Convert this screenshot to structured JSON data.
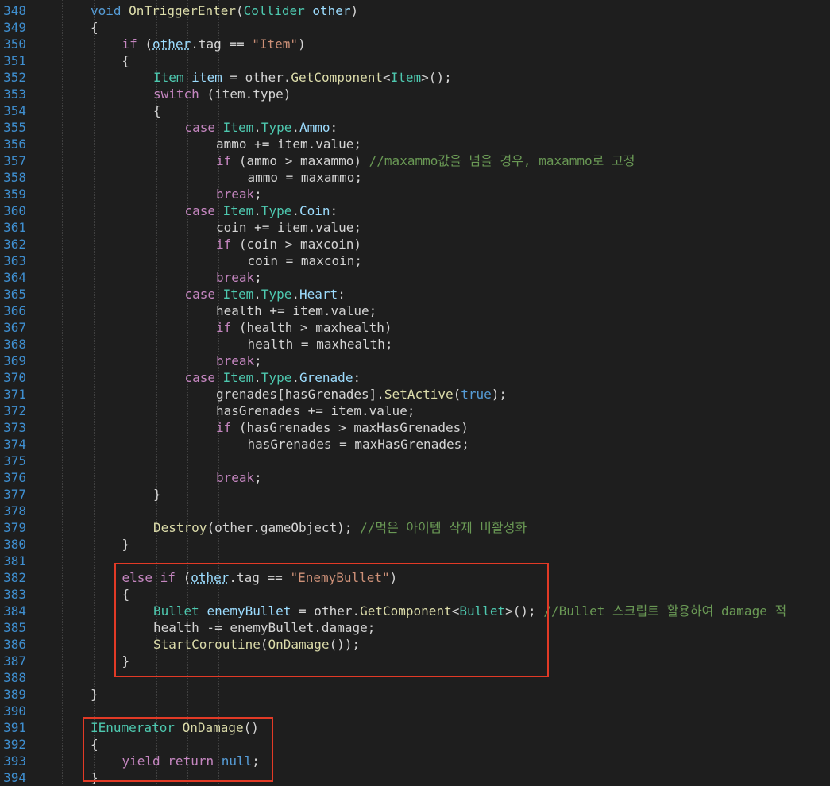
{
  "editor": {
    "language": "C#",
    "colors": {
      "background": "#1e1e1e",
      "line_number": "#3f8fd0",
      "keyword": "#569cd6",
      "control": "#c586c0",
      "function": "#dcdcaa",
      "type": "#4ec9b0",
      "string": "#ce9178",
      "comment": "#6a9955",
      "highlight_box": "#e23a26"
    },
    "lines": [
      {
        "n": "348",
        "indent": 1,
        "tokens": [
          [
            "kw",
            "void "
          ],
          [
            "fn",
            "OnTriggerEnter"
          ],
          [
            "plain",
            "("
          ],
          [
            "ty",
            "Collider"
          ],
          [
            "plain",
            " "
          ],
          [
            "var",
            "other"
          ],
          [
            "plain",
            ")"
          ]
        ]
      },
      {
        "n": "349",
        "indent": 1,
        "tokens": [
          [
            "plain",
            "{"
          ]
        ]
      },
      {
        "n": "350",
        "indent": 2,
        "tokens": [
          [
            "ctl",
            "if"
          ],
          [
            "plain",
            " ("
          ],
          [
            "dotvar",
            "other"
          ],
          [
            "plain",
            ".tag == "
          ],
          [
            "str",
            "\"Item\""
          ],
          [
            "plain",
            ")"
          ]
        ]
      },
      {
        "n": "351",
        "indent": 2,
        "tokens": [
          [
            "plain",
            "{"
          ]
        ]
      },
      {
        "n": "352",
        "indent": 3,
        "tokens": [
          [
            "ty",
            "Item"
          ],
          [
            "plain",
            " "
          ],
          [
            "var",
            "item"
          ],
          [
            "plain",
            " = other."
          ],
          [
            "fn",
            "GetComponent"
          ],
          [
            "plain",
            "<"
          ],
          [
            "ty",
            "Item"
          ],
          [
            "plain",
            ">();"
          ]
        ]
      },
      {
        "n": "353",
        "indent": 3,
        "tokens": [
          [
            "ctl",
            "switch"
          ],
          [
            "plain",
            " (item.type)"
          ]
        ]
      },
      {
        "n": "354",
        "indent": 3,
        "tokens": [
          [
            "plain",
            "{"
          ]
        ]
      },
      {
        "n": "355",
        "indent": 4,
        "tokens": [
          [
            "ctl",
            "case"
          ],
          [
            "plain",
            " "
          ],
          [
            "ty",
            "Item"
          ],
          [
            "plain",
            "."
          ],
          [
            "ty",
            "Type"
          ],
          [
            "plain",
            "."
          ],
          [
            "var",
            "Ammo"
          ],
          [
            "plain",
            ":"
          ]
        ]
      },
      {
        "n": "356",
        "indent": 5,
        "tokens": [
          [
            "plain",
            "ammo += item.value;"
          ]
        ]
      },
      {
        "n": "357",
        "indent": 5,
        "tokens": [
          [
            "ctl",
            "if"
          ],
          [
            "plain",
            " (ammo > maxammo) "
          ],
          [
            "cm",
            "//maxammo값을 넘을 경우, maxammo로 고정"
          ]
        ]
      },
      {
        "n": "358",
        "indent": 6,
        "tokens": [
          [
            "plain",
            "ammo = maxammo;"
          ]
        ]
      },
      {
        "n": "359",
        "indent": 5,
        "tokens": [
          [
            "ctl",
            "break"
          ],
          [
            "plain",
            ";"
          ]
        ]
      },
      {
        "n": "360",
        "indent": 4,
        "tokens": [
          [
            "ctl",
            "case"
          ],
          [
            "plain",
            " "
          ],
          [
            "ty",
            "Item"
          ],
          [
            "plain",
            "."
          ],
          [
            "ty",
            "Type"
          ],
          [
            "plain",
            "."
          ],
          [
            "var",
            "Coin"
          ],
          [
            "plain",
            ":"
          ]
        ]
      },
      {
        "n": "361",
        "indent": 5,
        "tokens": [
          [
            "plain",
            "coin += item.value;"
          ]
        ]
      },
      {
        "n": "362",
        "indent": 5,
        "tokens": [
          [
            "ctl",
            "if"
          ],
          [
            "plain",
            " (coin > maxcoin)"
          ]
        ]
      },
      {
        "n": "363",
        "indent": 6,
        "tokens": [
          [
            "plain",
            "coin = maxcoin;"
          ]
        ]
      },
      {
        "n": "364",
        "indent": 5,
        "tokens": [
          [
            "ctl",
            "break"
          ],
          [
            "plain",
            ";"
          ]
        ]
      },
      {
        "n": "365",
        "indent": 4,
        "tokens": [
          [
            "ctl",
            "case"
          ],
          [
            "plain",
            " "
          ],
          [
            "ty",
            "Item"
          ],
          [
            "plain",
            "."
          ],
          [
            "ty",
            "Type"
          ],
          [
            "plain",
            "."
          ],
          [
            "var",
            "Heart"
          ],
          [
            "plain",
            ":"
          ]
        ]
      },
      {
        "n": "366",
        "indent": 5,
        "tokens": [
          [
            "plain",
            "health += item.value;"
          ]
        ]
      },
      {
        "n": "367",
        "indent": 5,
        "tokens": [
          [
            "ctl",
            "if"
          ],
          [
            "plain",
            " (health > maxhealth)"
          ]
        ]
      },
      {
        "n": "368",
        "indent": 6,
        "tokens": [
          [
            "plain",
            "health = maxhealth;"
          ]
        ]
      },
      {
        "n": "369",
        "indent": 5,
        "tokens": [
          [
            "ctl",
            "break"
          ],
          [
            "plain",
            ";"
          ]
        ]
      },
      {
        "n": "370",
        "indent": 4,
        "tokens": [
          [
            "ctl",
            "case"
          ],
          [
            "plain",
            " "
          ],
          [
            "ty",
            "Item"
          ],
          [
            "plain",
            "."
          ],
          [
            "ty",
            "Type"
          ],
          [
            "plain",
            "."
          ],
          [
            "var",
            "Grenade"
          ],
          [
            "plain",
            ":"
          ]
        ]
      },
      {
        "n": "371",
        "indent": 5,
        "tokens": [
          [
            "plain",
            "grenades[hasGrenades]."
          ],
          [
            "fn",
            "SetActive"
          ],
          [
            "plain",
            "("
          ],
          [
            "kw",
            "true"
          ],
          [
            "plain",
            ");"
          ]
        ]
      },
      {
        "n": "372",
        "indent": 5,
        "tokens": [
          [
            "plain",
            "hasGrenades += item.value;"
          ]
        ]
      },
      {
        "n": "373",
        "indent": 5,
        "tokens": [
          [
            "ctl",
            "if"
          ],
          [
            "plain",
            " (hasGrenades > maxHasGrenades)"
          ]
        ]
      },
      {
        "n": "374",
        "indent": 6,
        "tokens": [
          [
            "plain",
            "hasGrenades = maxHasGrenades;"
          ]
        ]
      },
      {
        "n": "375",
        "indent": 0,
        "tokens": []
      },
      {
        "n": "376",
        "indent": 5,
        "tokens": [
          [
            "ctl",
            "break"
          ],
          [
            "plain",
            ";"
          ]
        ]
      },
      {
        "n": "377",
        "indent": 3,
        "tokens": [
          [
            "plain",
            "}"
          ]
        ]
      },
      {
        "n": "378",
        "indent": 0,
        "tokens": []
      },
      {
        "n": "379",
        "indent": 3,
        "tokens": [
          [
            "fn",
            "Destroy"
          ],
          [
            "plain",
            "(other.gameObject); "
          ],
          [
            "cm",
            "//먹은 아이템 삭제 비활성화"
          ]
        ]
      },
      {
        "n": "380",
        "indent": 2,
        "tokens": [
          [
            "plain",
            "}"
          ]
        ]
      },
      {
        "n": "381",
        "indent": 0,
        "tokens": []
      },
      {
        "n": "382",
        "indent": 2,
        "tokens": [
          [
            "ctl",
            "else if"
          ],
          [
            "plain",
            " ("
          ],
          [
            "dotvar",
            "other"
          ],
          [
            "plain",
            ".tag == "
          ],
          [
            "str",
            "\"EnemyBullet\""
          ],
          [
            "plain",
            ")"
          ]
        ]
      },
      {
        "n": "383",
        "indent": 2,
        "tokens": [
          [
            "plain",
            "{"
          ]
        ]
      },
      {
        "n": "384",
        "indent": 3,
        "tokens": [
          [
            "ty",
            "Bullet"
          ],
          [
            "plain",
            " "
          ],
          [
            "var",
            "enemyBullet"
          ],
          [
            "plain",
            " = other."
          ],
          [
            "fn",
            "GetComponent"
          ],
          [
            "plain",
            "<"
          ],
          [
            "ty",
            "Bullet"
          ],
          [
            "plain",
            ">(); "
          ],
          [
            "cm",
            "//Bullet 스크립트 활용하여 damage 적"
          ]
        ]
      },
      {
        "n": "385",
        "indent": 3,
        "tokens": [
          [
            "plain",
            "health -= enemyBullet.damage;"
          ]
        ]
      },
      {
        "n": "386",
        "indent": 3,
        "tokens": [
          [
            "fn",
            "StartCoroutine"
          ],
          [
            "plain",
            "("
          ],
          [
            "fn",
            "OnDamage"
          ],
          [
            "plain",
            "());"
          ]
        ]
      },
      {
        "n": "387",
        "indent": 2,
        "tokens": [
          [
            "plain",
            "}"
          ]
        ]
      },
      {
        "n": "388",
        "indent": 0,
        "tokens": []
      },
      {
        "n": "389",
        "indent": 1,
        "tokens": [
          [
            "plain",
            "}"
          ]
        ]
      },
      {
        "n": "390",
        "indent": 0,
        "tokens": []
      },
      {
        "n": "391",
        "indent": 1,
        "tokens": [
          [
            "ty",
            "IEnumerator"
          ],
          [
            "plain",
            " "
          ],
          [
            "fn",
            "OnDamage"
          ],
          [
            "plain",
            "()"
          ]
        ]
      },
      {
        "n": "392",
        "indent": 1,
        "tokens": [
          [
            "plain",
            "{"
          ]
        ]
      },
      {
        "n": "393",
        "indent": 2,
        "tokens": [
          [
            "ctl",
            "yield return"
          ],
          [
            "plain",
            " "
          ],
          [
            "kw",
            "null"
          ],
          [
            "plain",
            ";"
          ]
        ]
      },
      {
        "n": "394",
        "indent": 1,
        "tokens": [
          [
            "plain",
            "}"
          ]
        ]
      }
    ]
  }
}
